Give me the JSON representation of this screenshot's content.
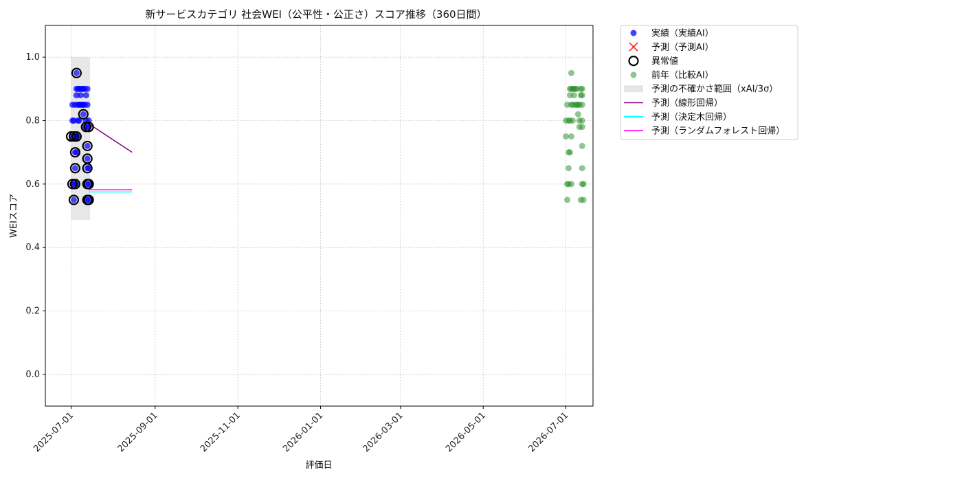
{
  "chart_data": {
    "type": "scatter",
    "title": "新サービスカテゴリ 社会WEI（公平性・公正さ）スコア推移（360日間）",
    "xlabel": "評価日",
    "ylabel": "WEIスコア",
    "xlim": [
      "2025-06-12",
      "2026-07-21"
    ],
    "ylim": [
      -0.1,
      1.1
    ],
    "xticks": [
      "2025-07-01",
      "2025-09-01",
      "2025-11-01",
      "2026-01-01",
      "2026-03-01",
      "2026-05-01",
      "2026-07-01"
    ],
    "yticks": [
      0.0,
      0.2,
      0.4,
      0.6,
      0.8,
      1.0
    ],
    "yticklabels": [
      "0.0",
      "0.2",
      "0.4",
      "0.6",
      "0.8",
      "1.0"
    ],
    "grid": true,
    "legend_position": "outside-top-right",
    "colors": {
      "actual": "#0000ff",
      "prev_year": "#228b22",
      "uncertainty": "#d3d3d3",
      "linear": "#800080",
      "tree": "#00ffff",
      "forest": "#ff00ff",
      "predicted": "#ff0000",
      "outlier": "#000000"
    },
    "series": [
      {
        "name": "実績（実績AI）",
        "kind": "scatter",
        "points": [
          [
            "2025-07-02",
            0.75
          ],
          [
            "2025-07-02",
            0.85
          ],
          [
            "2025-07-02",
            0.8
          ],
          [
            "2025-07-02",
            0.6
          ],
          [
            "2025-07-03",
            0.55
          ],
          [
            "2025-07-03",
            0.8
          ],
          [
            "2025-07-03",
            0.75
          ],
          [
            "2025-07-03",
            0.6
          ],
          [
            "2025-07-04",
            0.7
          ],
          [
            "2025-07-04",
            0.65
          ],
          [
            "2025-07-04",
            0.85
          ],
          [
            "2025-07-05",
            0.88
          ],
          [
            "2025-07-05",
            0.9
          ],
          [
            "2025-07-05",
            0.95
          ],
          [
            "2025-07-05",
            0.75
          ],
          [
            "2025-07-05",
            0.7
          ],
          [
            "2025-07-05",
            0.6
          ],
          [
            "2025-07-06",
            0.8
          ],
          [
            "2025-07-06",
            0.85
          ],
          [
            "2025-07-06",
            0.9
          ],
          [
            "2025-07-06",
            0.75
          ],
          [
            "2025-07-07",
            0.8
          ],
          [
            "2025-07-07",
            0.9
          ],
          [
            "2025-07-07",
            0.85
          ],
          [
            "2025-07-08",
            0.88
          ],
          [
            "2025-07-08",
            0.9
          ],
          [
            "2025-07-08",
            0.85
          ],
          [
            "2025-07-09",
            0.9
          ],
          [
            "2025-07-09",
            0.85
          ],
          [
            "2025-07-10",
            0.9
          ],
          [
            "2025-07-10",
            0.85
          ],
          [
            "2025-07-10",
            0.82
          ],
          [
            "2025-07-11",
            0.85
          ],
          [
            "2025-07-11",
            0.9
          ],
          [
            "2025-07-11",
            0.78
          ],
          [
            "2025-07-12",
            0.8
          ],
          [
            "2025-07-12",
            0.88
          ],
          [
            "2025-07-13",
            0.78
          ],
          [
            "2025-07-13",
            0.72
          ],
          [
            "2025-07-13",
            0.68
          ],
          [
            "2025-07-13",
            0.65
          ],
          [
            "2025-07-13",
            0.6
          ],
          [
            "2025-07-13",
            0.55
          ],
          [
            "2025-07-13",
            0.85
          ],
          [
            "2025-07-13",
            0.9
          ],
          [
            "2025-07-14",
            0.8
          ],
          [
            "2025-07-14",
            0.78
          ],
          [
            "2025-07-14",
            0.65
          ],
          [
            "2025-07-14",
            0.6
          ],
          [
            "2025-07-14",
            0.55
          ]
        ]
      },
      {
        "name": "異常値",
        "kind": "outlier",
        "points": [
          [
            "2025-07-01",
            0.75
          ],
          [
            "2025-07-02",
            0.6
          ],
          [
            "2025-07-03",
            0.55
          ],
          [
            "2025-07-03",
            0.75
          ],
          [
            "2025-07-04",
            0.7
          ],
          [
            "2025-07-04",
            0.65
          ],
          [
            "2025-07-05",
            0.95
          ],
          [
            "2025-07-05",
            0.75
          ],
          [
            "2025-07-04",
            0.6
          ],
          [
            "2025-07-10",
            0.82
          ],
          [
            "2025-07-12",
            0.78
          ],
          [
            "2025-07-13",
            0.72
          ],
          [
            "2025-07-13",
            0.68
          ],
          [
            "2025-07-13",
            0.65
          ],
          [
            "2025-07-13",
            0.6
          ],
          [
            "2025-07-13",
            0.55
          ],
          [
            "2025-07-14",
            0.78
          ],
          [
            "2025-07-14",
            0.6
          ],
          [
            "2025-07-14",
            0.55
          ]
        ]
      },
      {
        "name": "前年（比較AI）",
        "kind": "scatter",
        "points": [
          [
            "2026-07-01",
            0.8
          ],
          [
            "2026-07-01",
            0.75
          ],
          [
            "2026-07-02",
            0.85
          ],
          [
            "2026-07-02",
            0.6
          ],
          [
            "2026-07-02",
            0.55
          ],
          [
            "2026-07-03",
            0.8
          ],
          [
            "2026-07-03",
            0.7
          ],
          [
            "2026-07-03",
            0.65
          ],
          [
            "2026-07-03",
            0.6
          ],
          [
            "2026-07-04",
            0.7
          ],
          [
            "2026-07-04",
            0.8
          ],
          [
            "2026-07-04",
            0.88
          ],
          [
            "2026-07-04",
            0.9
          ],
          [
            "2026-07-05",
            0.95
          ],
          [
            "2026-07-05",
            0.85
          ],
          [
            "2026-07-05",
            0.75
          ],
          [
            "2026-07-05",
            0.6
          ],
          [
            "2026-07-05",
            0.9
          ],
          [
            "2026-07-06",
            0.8
          ],
          [
            "2026-07-06",
            0.85
          ],
          [
            "2026-07-06",
            0.9
          ],
          [
            "2026-07-07",
            0.88
          ],
          [
            "2026-07-07",
            0.9
          ],
          [
            "2026-07-08",
            0.9
          ],
          [
            "2026-07-08",
            0.85
          ],
          [
            "2026-07-09",
            0.9
          ],
          [
            "2026-07-09",
            0.85
          ],
          [
            "2026-07-10",
            0.82
          ],
          [
            "2026-07-10",
            0.85
          ],
          [
            "2026-07-11",
            0.78
          ],
          [
            "2026-07-11",
            0.8
          ],
          [
            "2026-07-11",
            0.85
          ],
          [
            "2026-07-12",
            0.88
          ],
          [
            "2026-07-12",
            0.9
          ],
          [
            "2026-07-12",
            0.55
          ],
          [
            "2026-07-13",
            0.72
          ],
          [
            "2026-07-13",
            0.65
          ],
          [
            "2026-07-13",
            0.6
          ],
          [
            "2026-07-13",
            0.8
          ],
          [
            "2026-07-13",
            0.78
          ],
          [
            "2026-07-13",
            0.85
          ],
          [
            "2026-07-13",
            0.9
          ],
          [
            "2026-07-13",
            0.88
          ],
          [
            "2026-07-14",
            0.6
          ],
          [
            "2026-07-14",
            0.55
          ]
        ]
      },
      {
        "name": "予測の不確かさ範囲（xAI/3σ）",
        "kind": "band",
        "x": [
          "2025-07-01",
          "2025-07-15"
        ],
        "y": [
          0.487,
          1.0
        ]
      },
      {
        "name": "予測（線形回帰）",
        "kind": "line",
        "points": [
          [
            "2025-07-14",
            0.79
          ],
          [
            "2025-08-15",
            0.7
          ]
        ]
      },
      {
        "name": "予測（決定木回帰）",
        "kind": "line",
        "points": [
          [
            "2025-07-14",
            0.575
          ],
          [
            "2025-08-15",
            0.575
          ]
        ]
      },
      {
        "name": "予測（ランダムフォレスト回帰）",
        "kind": "line",
        "points": [
          [
            "2025-07-14",
            0.582
          ],
          [
            "2025-08-15",
            0.582
          ]
        ]
      }
    ],
    "legend": [
      {
        "label": "実績（実績AI）",
        "icon": "blue-dot-icon"
      },
      {
        "label": "予測（予測AI）",
        "icon": "red-x-icon"
      },
      {
        "label": "異常値",
        "icon": "black-ring-icon"
      },
      {
        "label": "前年（比較AI）",
        "icon": "green-dot-icon"
      },
      {
        "label": "予測の不確かさ範囲（xAI/3σ）",
        "icon": "gray-band-icon"
      },
      {
        "label": "予測（線形回帰）",
        "icon": "purple-line-icon"
      },
      {
        "label": "予測（決定木回帰）",
        "icon": "cyan-line-icon"
      },
      {
        "label": "予測（ランダムフォレスト回帰）",
        "icon": "magenta-line-icon"
      }
    ]
  }
}
